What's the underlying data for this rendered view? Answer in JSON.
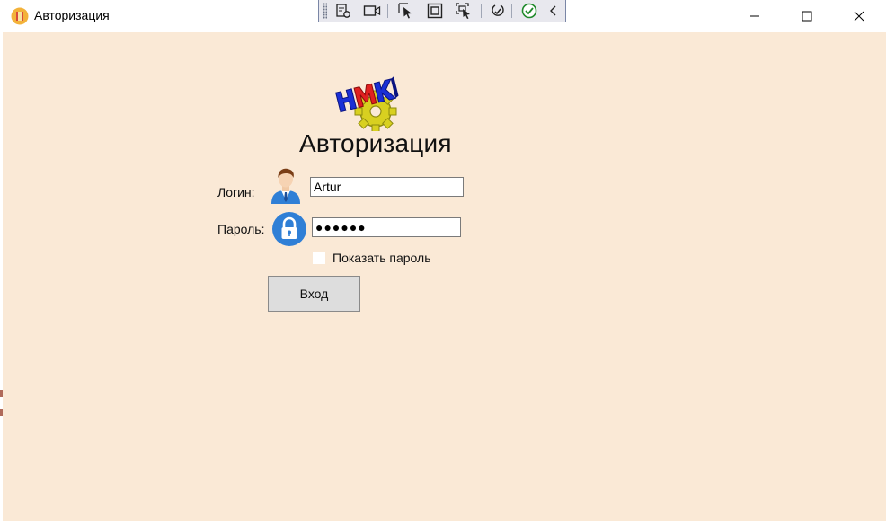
{
  "window": {
    "title": "Авторизация",
    "controls": {
      "minimize": "minimize-icon",
      "maximize": "maximize-icon",
      "close": "close-icon"
    }
  },
  "dev_toolbar": {
    "icons": [
      "visual-tree-icon",
      "record-icon",
      "select-element-icon",
      "display-layout-adorners-icon",
      "track-focus-icon",
      "binding-failures-icon",
      "accessibility-check-icon",
      "collapse-icon"
    ]
  },
  "form": {
    "heading": "Авторизация",
    "login_label": "Логин:",
    "login_value": "Artur",
    "password_label": "Пароль:",
    "password_value": "●●●●●●",
    "show_password_label": "Показать пароль",
    "show_password_checked": false,
    "login_button": "Вход"
  },
  "colors": {
    "background": "#fae9d6",
    "button": "#dddddd",
    "logo_blue": "#1a2fd6",
    "logo_red": "#e02020",
    "logo_yellow": "#d8d020",
    "lock_blue": "#2f7fd6"
  }
}
